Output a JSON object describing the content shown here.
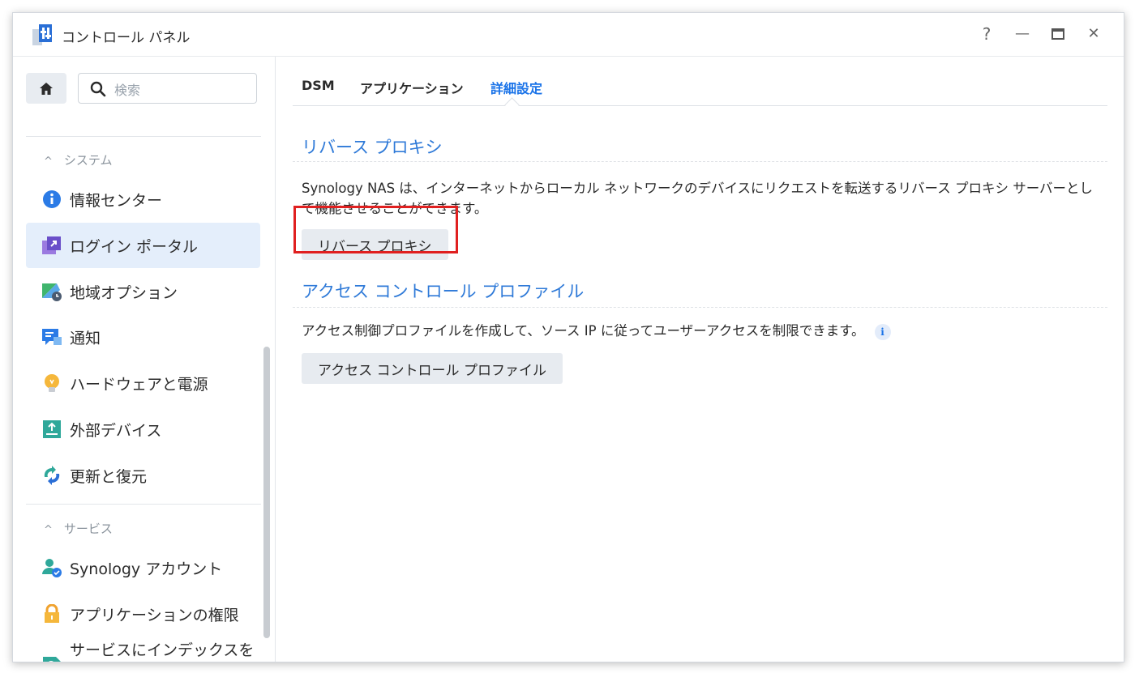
{
  "window": {
    "title": "コントロール パネル"
  },
  "window_controls": {
    "help": "?",
    "minimize": "—",
    "maximize": "▭",
    "close": "✕"
  },
  "sidebar": {
    "search_placeholder": "検索",
    "sections": [
      {
        "label": "システム",
        "chevron": "^"
      },
      {
        "label": "サービス",
        "chevron": "^"
      }
    ],
    "items": [
      {
        "label": "情報センター",
        "icon": "info-icon",
        "active": false
      },
      {
        "label": "ログイン ポータル",
        "icon": "login-portal-icon",
        "active": true
      },
      {
        "label": "地域オプション",
        "icon": "regional-options-icon",
        "active": false
      },
      {
        "label": "通知",
        "icon": "notification-icon",
        "active": false
      },
      {
        "label": "ハードウェアと電源",
        "icon": "hardware-power-icon",
        "active": false
      },
      {
        "label": "外部デバイス",
        "icon": "external-devices-icon",
        "active": false
      },
      {
        "label": "更新と復元",
        "icon": "update-restore-icon",
        "active": false
      },
      {
        "label": "Synology アカウント",
        "icon": "synology-account-icon",
        "active": false
      },
      {
        "label": "アプリケーションの権限",
        "icon": "app-privileges-icon",
        "active": false
      },
      {
        "label": "サービスにインデックスを付けています",
        "icon": "indexing-service-icon",
        "active": false
      }
    ]
  },
  "tabs": [
    {
      "label": "DSM",
      "active": false
    },
    {
      "label": "アプリケーション",
      "active": false
    },
    {
      "label": "詳細設定",
      "active": true
    }
  ],
  "sections": {
    "reverse_proxy": {
      "title": "リバース プロキシ",
      "description": "Synology NAS は、インターネットからローカル ネットワークのデバイスにリクエストを転送するリバース プロキシ サーバーとして機能させることができます。",
      "button": "リバース プロキシ"
    },
    "access_control": {
      "title": "アクセス コントロール プロファイル",
      "description": "アクセス制御プロファイルを作成して、ソース IP に従ってユーザーアクセスを制限できます。",
      "info_glyph": "i",
      "button": "アクセス コントロール プロファイル"
    }
  },
  "colors": {
    "accent": "#2f7ad8",
    "highlight": "#e02020",
    "active_bg": "#e4eefb"
  }
}
